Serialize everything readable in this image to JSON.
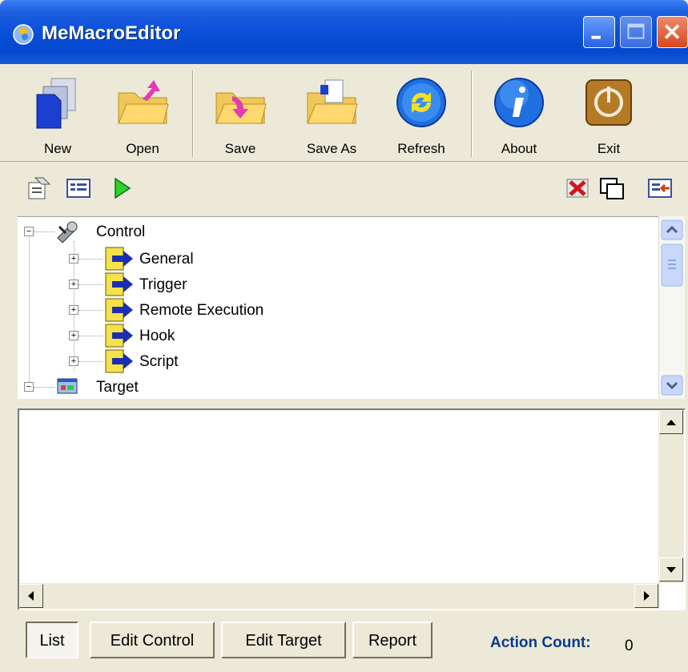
{
  "window": {
    "title": "MeMacroEditor"
  },
  "toolbar": {
    "buttons": [
      {
        "label": "New",
        "icon": "new-document-icon"
      },
      {
        "label": "Open",
        "icon": "open-folder-icon"
      },
      {
        "label": "Save",
        "icon": "save-folder-icon"
      },
      {
        "label": "Save As",
        "icon": "save-as-folder-icon"
      },
      {
        "label": "Refresh",
        "icon": "refresh-icon"
      },
      {
        "label": "About",
        "icon": "info-icon"
      },
      {
        "label": "Exit",
        "icon": "power-icon"
      }
    ]
  },
  "tree": {
    "root_control": "Control",
    "children": [
      "General",
      "Trigger",
      "Remote Execution",
      "Hook",
      "Script"
    ],
    "root_target": "Target"
  },
  "tabs": {
    "list": "List",
    "edit_control": "Edit Control",
    "edit_target": "Edit Target",
    "report": "Report"
  },
  "status": {
    "action_count_label": "Action Count:",
    "action_count_value": "0"
  },
  "colors": {
    "titlebar": "#0a4fd8",
    "face": "#ece9d8",
    "accent_text": "#0a3a8c"
  }
}
